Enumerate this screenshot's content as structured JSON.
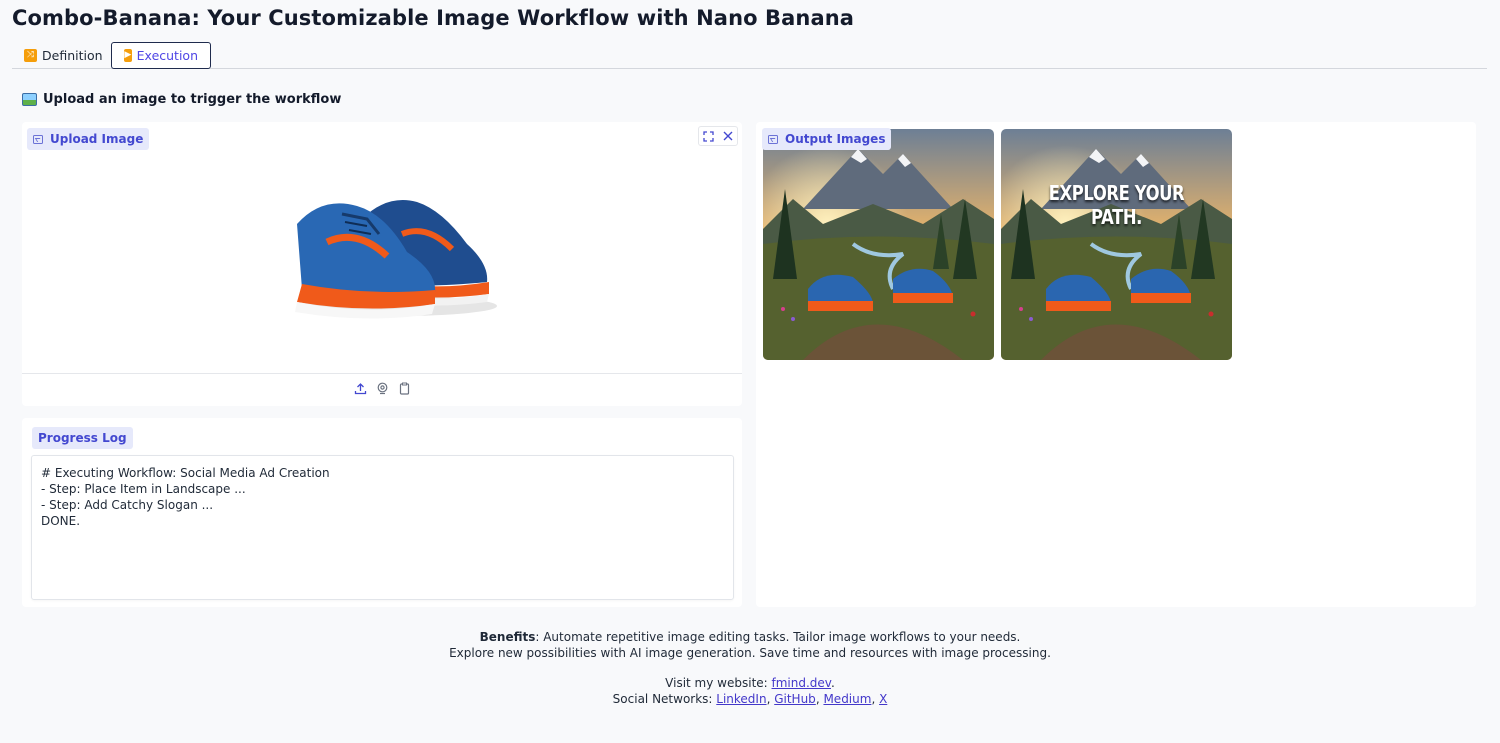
{
  "app": {
    "title": "Combo-Banana: Your Customizable Image Workflow with Nano Banana"
  },
  "tabs": [
    {
      "label": "Definition",
      "icon": "shuffle-icon",
      "active": false
    },
    {
      "label": "Execution",
      "icon": "play-icon",
      "active": true
    }
  ],
  "section": {
    "heading": "Upload an image to trigger the workflow",
    "icon": "picture-icon"
  },
  "upload": {
    "label": "Upload Image",
    "image": "blue running shoes with orange accents",
    "toolbar": [
      "upload-icon",
      "webcam-icon",
      "clipboard-icon"
    ],
    "corner_buttons": [
      "fullscreen-icon",
      "close-icon"
    ]
  },
  "progress": {
    "label": "Progress Log",
    "log": "# Executing Workflow: Social Media Ad Creation\n- Step: Place Item in Landscape ...\n- Step: Add Catchy Slogan ...\nDONE."
  },
  "output": {
    "label": "Output Images",
    "images": [
      {
        "caption": ""
      },
      {
        "caption": "EXPLORE YOUR PATH."
      }
    ]
  },
  "footer": {
    "benefits_label": "Benefits",
    "benefits_text_1": ": Automate repetitive image editing tasks. Tailor image workflows to your needs.",
    "benefits_text_2": "Explore new possibilities with AI image generation. Save time and resources with image processing.",
    "visit_prefix": "Visit my website: ",
    "website_link": "fmind.dev",
    "visit_suffix": ".",
    "social_prefix": "Social Networks: ",
    "social_links": [
      "LinkedIn",
      "GitHub",
      "Medium",
      "X"
    ]
  },
  "colors": {
    "accent": "#4f46e5",
    "badge_bg": "#e6e9fb",
    "page_bg": "#f8f9fb"
  }
}
